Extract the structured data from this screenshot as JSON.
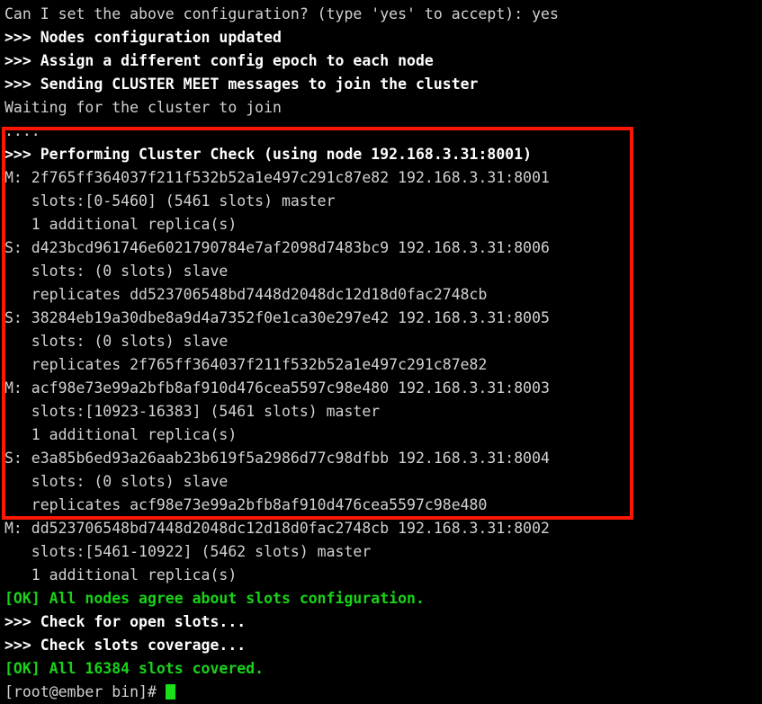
{
  "terminal": {
    "background_color": "#000000",
    "plain_text_color": "#d2d2d2",
    "bold_white_color": "#ffffff",
    "green_color": "#18d318",
    "highlight_box_color": "#fb1703",
    "lines": [
      {
        "text": "Can I set the above configuration? (type 'yes' to accept): yes",
        "style": "plain"
      },
      {
        "text": ">>> Nodes configuration updated",
        "style": "white"
      },
      {
        "text": ">>> Assign a different config epoch to each node",
        "style": "white"
      },
      {
        "text": ">>> Sending CLUSTER MEET messages to join the cluster",
        "style": "white"
      },
      {
        "text": "Waiting for the cluster to join",
        "style": "plain"
      },
      {
        "text": "....",
        "style": "plain"
      },
      {
        "text": ">>> Performing Cluster Check (using node 192.168.3.31:8001)",
        "style": "white"
      },
      {
        "text": "M: 2f765ff364037f211f532b52a1e497c291c87e82 192.168.3.31:8001",
        "style": "plain"
      },
      {
        "text": "   slots:[0-5460] (5461 slots) master",
        "style": "plain"
      },
      {
        "text": "   1 additional replica(s)",
        "style": "plain"
      },
      {
        "text": "S: d423bcd961746e6021790784e7af2098d7483bc9 192.168.3.31:8006",
        "style": "plain"
      },
      {
        "text": "   slots: (0 slots) slave",
        "style": "plain"
      },
      {
        "text": "   replicates dd523706548bd7448d2048dc12d18d0fac2748cb",
        "style": "plain"
      },
      {
        "text": "S: 38284eb19a30dbe8a9d4a7352f0e1ca30e297e42 192.168.3.31:8005",
        "style": "plain"
      },
      {
        "text": "   slots: (0 slots) slave",
        "style": "plain"
      },
      {
        "text": "   replicates 2f765ff364037f211f532b52a1e497c291c87e82",
        "style": "plain"
      },
      {
        "text": "M: acf98e73e99a2bfb8af910d476cea5597c98e480 192.168.3.31:8003",
        "style": "plain"
      },
      {
        "text": "   slots:[10923-16383] (5461 slots) master",
        "style": "plain"
      },
      {
        "text": "   1 additional replica(s)",
        "style": "plain"
      },
      {
        "text": "S: e3a85b6ed93a26aab23b619f5a2986d77c98dfbb 192.168.3.31:8004",
        "style": "plain"
      },
      {
        "text": "   slots: (0 slots) slave",
        "style": "plain"
      },
      {
        "text": "   replicates acf98e73e99a2bfb8af910d476cea5597c98e480",
        "style": "plain"
      },
      {
        "text": "M: dd523706548bd7448d2048dc12d18d0fac2748cb 192.168.3.31:8002",
        "style": "plain"
      },
      {
        "text": "   slots:[5461-10922] (5462 slots) master",
        "style": "plain"
      },
      {
        "text": "   1 additional replica(s)",
        "style": "plain"
      },
      {
        "text": "[OK] All nodes agree about slots configuration.",
        "style": "green"
      },
      {
        "text": ">>> Check for open slots...",
        "style": "white"
      },
      {
        "text": ">>> Check slots coverage...",
        "style": "white"
      },
      {
        "text": "[OK] All 16384 slots covered.",
        "style": "green"
      }
    ],
    "prompt": {
      "text": "[root@ember bin]# ",
      "style": "plain"
    }
  }
}
